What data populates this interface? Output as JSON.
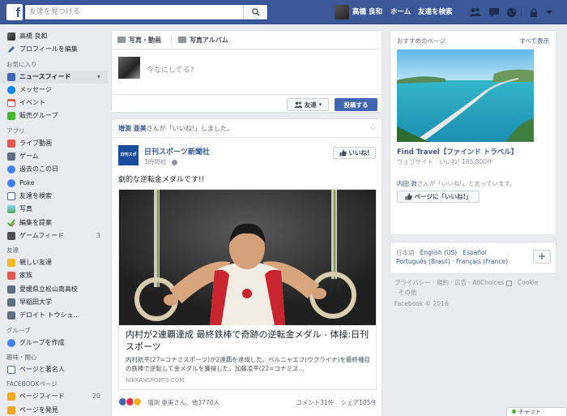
{
  "topbar": {
    "search_placeholder": "友達を見つける",
    "user_name": "高橋 良和",
    "home": "ホーム",
    "find_friends": "友達を検索"
  },
  "sidebar": {
    "profile_name": "高橋 良和",
    "edit_profile": "プロフィールを編集",
    "favorites_head": "お気に入り",
    "favorites": [
      {
        "label": "ニュースフィード",
        "icon": "newsfeed-icon"
      },
      {
        "label": "メッセージ",
        "icon": "messenger-icon"
      },
      {
        "label": "イベント",
        "icon": "calendar-icon"
      },
      {
        "label": "販売グループ",
        "icon": "sale-group-icon"
      }
    ],
    "apps_head": "アプリ",
    "apps": [
      {
        "label": "ライブ動画",
        "icon": "live-video-icon"
      },
      {
        "label": "ゲーム",
        "icon": "games-icon"
      },
      {
        "label": "過去のこの日",
        "icon": "on-this-day-icon"
      },
      {
        "label": "Poke",
        "icon": "poke-icon"
      },
      {
        "label": "友達を検索",
        "icon": "find-friends-icon"
      },
      {
        "label": "写真",
        "icon": "photos-icon"
      },
      {
        "label": "編集を提案",
        "icon": "suggest-edits-icon"
      },
      {
        "label": "ゲームフィード",
        "icon": "games-feed-icon",
        "count": "3"
      }
    ],
    "friends_head": "友達",
    "friends": [
      {
        "label": "親しい友達",
        "icon": "close-friends-icon"
      },
      {
        "label": "家族",
        "icon": "family-icon"
      },
      {
        "label": "愛媛県立松山南高校",
        "icon": "school-icon"
      },
      {
        "label": "早稲田大学",
        "icon": "university-icon"
      },
      {
        "label": "デロイト トウシュ...",
        "icon": "work-icon"
      }
    ],
    "groups_head": "グループ",
    "groups": [
      {
        "label": "グループを作成",
        "icon": "create-group-icon"
      }
    ],
    "interests_head": "趣味・関心",
    "interests": [
      {
        "label": "ページと著名人",
        "icon": "pages-icon"
      }
    ],
    "pages_head": "FACEBOOKページ",
    "pages": [
      {
        "label": "ページフィード",
        "icon": "pages-feed-icon",
        "count": "20"
      },
      {
        "label": "ページを発見",
        "icon": "discover-pages-icon"
      }
    ]
  },
  "composer": {
    "tab_photo_video": "写真・動画",
    "tab_album": "写真アルバム",
    "placeholder": "今なにしてる?",
    "audience": "友達",
    "post_button": "投稿する"
  },
  "post": {
    "liker": "増渕 亜美",
    "liked_text": "さんが「いいね!」しました。",
    "page_logo": "日刊スポーツ",
    "page_name": "日刊スポーツ新聞社",
    "time": "3時間前 ·",
    "like_button": "いいね!",
    "message": "劇的な逆転金メダルです!!",
    "link_title": "内村が2連覇達成 最終鉄棒で奇跡の逆転金メダル - 体操:日刊スポーツ",
    "link_desc": "内村航平(27=コナミスポーツ)が2連覇を達成した。ベルニャエフ(ウクライナ)を最終種目の鉄棒で逆転して金メダルを獲得した。加藤凌平(22=コナミス...",
    "link_domain": "NIKKANSPORTS.COM",
    "reactors": "増渕 亜美さん、他3770人",
    "comments": "コメント31件",
    "shares": "シェア105件"
  },
  "right": {
    "head": "おすすめのページ",
    "see_all": "すべて表示",
    "page_title": "Find Travel【ファインド トラベル】",
    "page_meta": "ウェブサイト · いいね! 185,800件",
    "friend_name": "内田 敦",
    "friend_liked": "さんが「いいね!」と言っています。",
    "like_page_button": "ページに「いいね!」",
    "lang_current": "日本語",
    "langs_line1": [
      "English (US)",
      "Español"
    ],
    "langs_line2": [
      "Português (Brasil)",
      "Français (France)"
    ],
    "footer_line1": "プライバシー · 規約 · 広告 · AdChoices",
    "footer_cookie": " · Cookie",
    "footer_line2": "· その他",
    "copyright": "Facebook © 2016"
  },
  "chat": {
    "label": "チャット"
  }
}
